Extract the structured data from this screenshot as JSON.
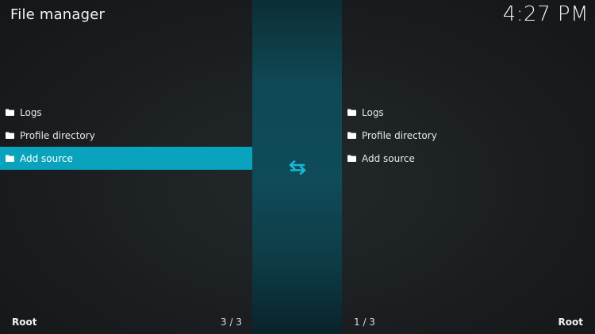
{
  "header": {
    "title": "File manager",
    "time": "4:27 PM"
  },
  "left_pane": {
    "items": [
      {
        "label": "Logs",
        "icon": "folder-icon"
      },
      {
        "label": "Profile directory",
        "icon": "folder-icon"
      },
      {
        "label": "Add source",
        "icon": "folder-icon",
        "selected": true
      }
    ],
    "footer_path": "Root",
    "footer_count": "3 / 3"
  },
  "right_pane": {
    "items": [
      {
        "label": "Logs",
        "icon": "folder-icon"
      },
      {
        "label": "Profile directory",
        "icon": "folder-icon"
      },
      {
        "label": "Add source",
        "icon": "folder-icon"
      }
    ],
    "footer_path": "Root",
    "footer_count": "1 / 3"
  },
  "center": {
    "icon": "swap-arrows-icon",
    "accent_color": "#1ab7d4"
  },
  "colors": {
    "selection": "#0aa3bd",
    "background": "#1b1e20"
  }
}
